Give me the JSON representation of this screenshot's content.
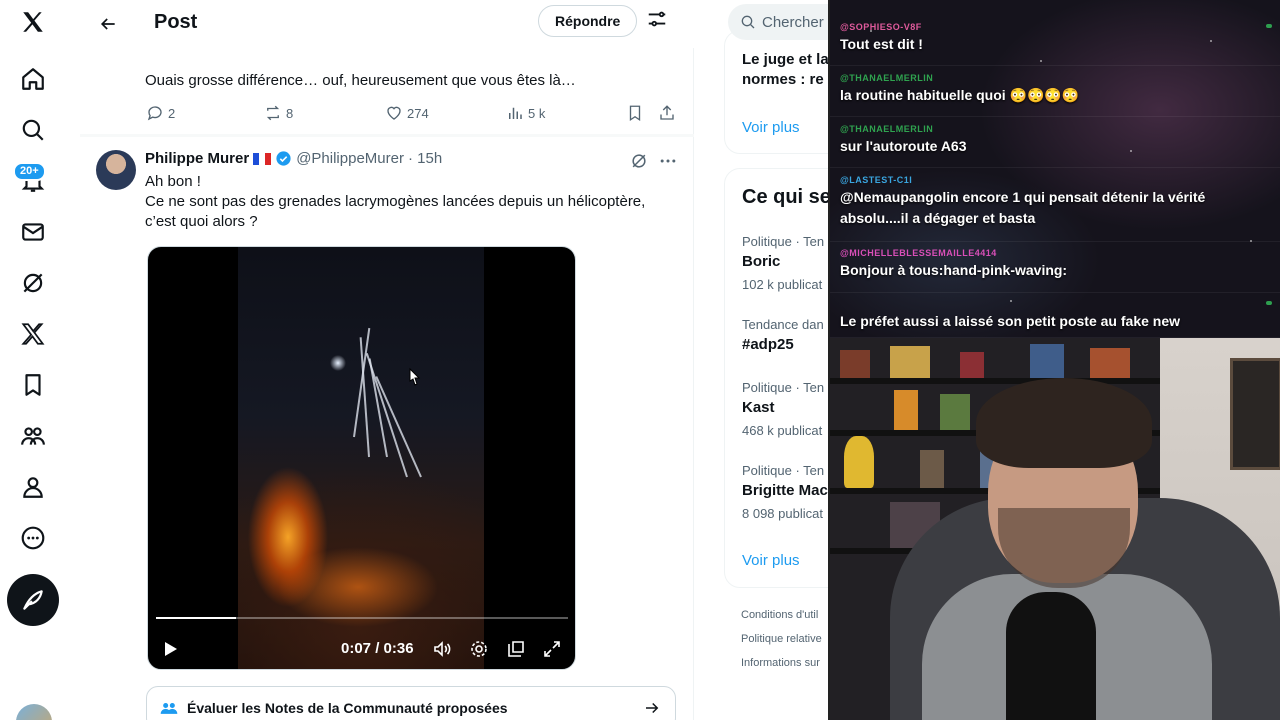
{
  "topbar": {
    "title": "Post",
    "reply_button": "Répondre"
  },
  "nav": {
    "notifications_badge": "20+"
  },
  "prev_reply": {
    "text": "Ouais grosse différence… ouf, heureusement que vous êtes là…",
    "replies": "2",
    "reposts": "8",
    "likes": "274",
    "views": "5 k"
  },
  "tweet": {
    "author": "Philippe Murer",
    "handle": "@PhilippeMurer",
    "time": "· 15h",
    "line1": "Ah bon !",
    "line2": "Ce ne sont pas des grenades lacrymogènes lancées depuis un hélicoptère,",
    "line3": "c’est quoi alors ?",
    "video_time": "0:07 / 0:36",
    "video_progress": 0.194
  },
  "notes_bar": {
    "label": "Évaluer les Notes de la Communauté proposées"
  },
  "sidebar": {
    "search_placeholder": "Chercher",
    "news_line1": "Le juge et la",
    "news_line2": "normes : re",
    "voir_plus": "Voir plus",
    "trends_title": "Ce qui se",
    "trends": [
      {
        "category": "Politique · Ten",
        "name": "Boric",
        "count": "102 k publicat"
      },
      {
        "category": "Tendance dan",
        "name": "#adp25",
        "count": ""
      },
      {
        "category": "Politique · Ten",
        "name": "Kast",
        "count": "468 k publicat"
      },
      {
        "category": "Politique · Ten",
        "name": "Brigitte Mac",
        "count": "8 098 publicat"
      }
    ],
    "footer": [
      "Conditions d'util",
      "Politique relative",
      "Informations sur"
    ]
  },
  "chat": {
    "messages": [
      {
        "user": "@SOPHIESO-V8F",
        "user_color": "#e05a9c",
        "text": "Tout est dit !"
      },
      {
        "user": "@THANAELMERLIN",
        "user_color": "#2fa34f",
        "text": "la routine habituelle quoi 😳😳😳😳"
      },
      {
        "user": "@THANAELMERLIN",
        "user_color": "#2fa34f",
        "text": "sur l'autoroute A63"
      },
      {
        "user": "@LASTEST-C1I",
        "user_color": "#3aa6e0",
        "text": "@Nemaupangolin encore 1 qui pensait détenir la vérité absolu....il a dégager et basta"
      },
      {
        "user": "@MICHELLEBLESSEMAILLE4414",
        "user_color": "#d94fb8",
        "text": "Bonjour à tous:hand-pink-waving:"
      },
      {
        "user": "",
        "user_color": "#d23a3a",
        "text": "Le préfet aussi a laissé son petit poste au fake new"
      }
    ]
  },
  "icons": {
    "nav": [
      "x-logo-icon",
      "home-icon",
      "search-icon",
      "notifications-icon",
      "messages-icon",
      "grok-icon",
      "premium-icon",
      "bookmarks-icon",
      "communities-icon",
      "profile-icon",
      "more-icon"
    ],
    "accent": "#1d9bf0"
  }
}
